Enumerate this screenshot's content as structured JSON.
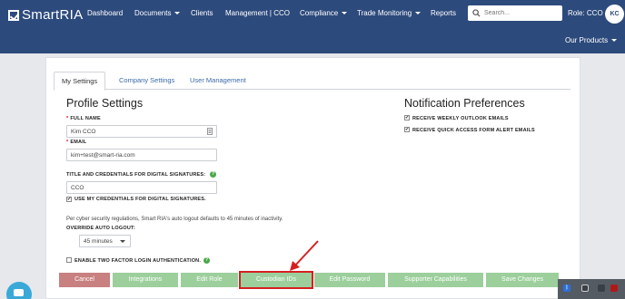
{
  "brand": {
    "name": "SmartRIA"
  },
  "nav": {
    "dashboard": "Dashboard",
    "documents": "Documents",
    "clients": "Clients",
    "management": "Management | CCO",
    "compliance": "Compliance",
    "trade_monitoring": "Trade Monitoring",
    "reports": "Reports",
    "our_products": "Our Products",
    "role": "Role: CCO",
    "avatar_initials": "KC"
  },
  "search": {
    "placeholder": "Search..."
  },
  "tabs": [
    "My Settings",
    "Company Settings",
    "User Management"
  ],
  "profile": {
    "title": "Profile Settings",
    "full_name_label": "FULL NAME",
    "full_name_value": "Kim CCO",
    "email_label": "EMAIL",
    "email_value": "kim+test@smart-ria.com",
    "credentials_label": "TITLE AND CREDENTIALS FOR DIGITAL SIGNATURES:",
    "credentials_value": "CCO",
    "use_credentials_label": "USE MY CREDENTIALS FOR DIGITAL SIGNATURES.",
    "logout_note": "Per cyber security regulations, Smart RIA's auto logout defaults to 45 minutes of inactivity.",
    "override_label": "OVERRIDE AUTO LOGOUT:",
    "override_value": "45 minutes",
    "two_factor_label": "ENABLE TWO FACTOR LOGIN AUTHENTICATION."
  },
  "notifications": {
    "title": "Notification Preferences",
    "weekly_label": "RECEIVE WEEKLY OUTLOOK EMAILS",
    "quick_access_label": "RECEIVE QUICK ACCESS FORM ALERT EMAILS"
  },
  "buttons": {
    "cancel": "Cancel",
    "integrations": "Integrations",
    "edit_role": "Edit Role",
    "custodian_ids": "Custodian IDs",
    "edit_password": "Edit Password",
    "supporter_capabilities": "Supporter Capabilities",
    "save_changes": "Save Changes"
  },
  "colors": {
    "navbar": "#2d4a7c",
    "button_green": "#9ccf9c",
    "button_cancel": "#c88080",
    "highlight_red": "#d52020"
  }
}
